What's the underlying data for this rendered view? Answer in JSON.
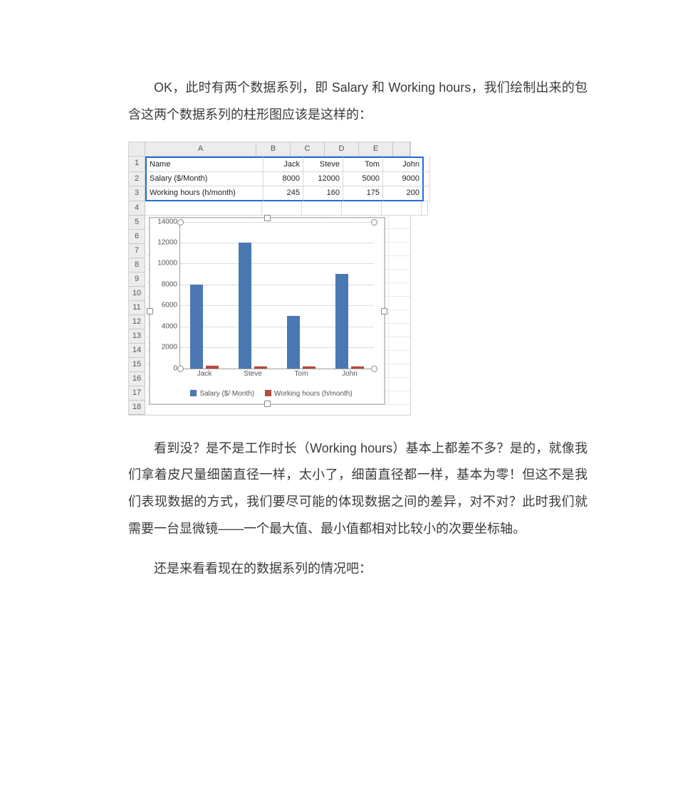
{
  "text": {
    "p1": "OK，此时有两个数据系列，即 Salary 和 Working hours，我们绘制出来的包含这两个数据系列的柱形图应该是这样的：",
    "p2": "看到没？是不是工作时长（Working hours）基本上都差不多？是的，就像我们拿着皮尺量细菌直径一样，太小了，细菌直径都一样，基本为零！但这不是我们表现数据的方式，我们要尽可能的体现数据之间的差异，对不对？此时我们就需要一台显微镜——一个最大值、最小值都相对比较小的次要坐标轴。",
    "p3": "还是来看看现在的数据系列的情况吧："
  },
  "sheet": {
    "col_letters": [
      "A",
      "B",
      "C",
      "D",
      "E"
    ],
    "row_nums_1_4": [
      "1",
      "2",
      "3",
      "4"
    ],
    "row_nums_chart": [
      "5",
      "6",
      "7",
      "8",
      "9",
      "10",
      "11",
      "12",
      "13",
      "14",
      "15",
      "16",
      "17",
      "18"
    ],
    "r1": {
      "a": "Name",
      "b": "Jack",
      "c": "Steve",
      "d": "Tom",
      "e": "John"
    },
    "r2": {
      "a": "Salary ($/Month)",
      "b": "8000",
      "c": "12000",
      "d": "5000",
      "e": "9000"
    },
    "r3": {
      "a": "Working hours (h/month)",
      "b": "245",
      "c": "160",
      "d": "175",
      "e": "200"
    }
  },
  "chart_data": {
    "type": "bar",
    "categories": [
      "Jack",
      "Steve",
      "Tom",
      "John"
    ],
    "series": [
      {
        "name": "Salary ($/ Month)",
        "values": [
          8000,
          12000,
          5000,
          9000
        ],
        "color": "#4a78b2"
      },
      {
        "name": "Working hours (h/month)",
        "values": [
          245,
          160,
          175,
          200
        ],
        "color": "#b84a3c"
      }
    ],
    "title": "",
    "xlabel": "",
    "ylabel": "",
    "ylim": [
      0,
      14000
    ],
    "ytick_step": 2000,
    "grid": true,
    "legend_position": "bottom"
  }
}
